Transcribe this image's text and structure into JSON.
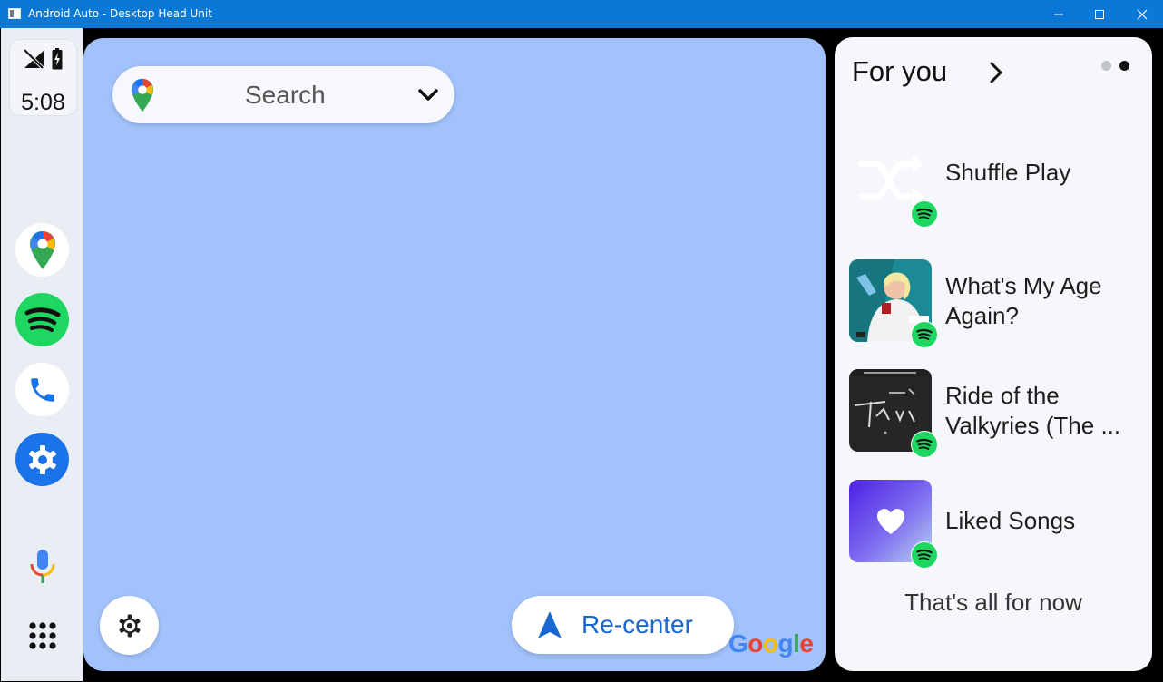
{
  "window": {
    "title": "Android Auto - Desktop Head Unit",
    "controls": [
      "minimize-icon",
      "maximize-icon",
      "close-icon"
    ]
  },
  "status": {
    "time": "5:08",
    "signal_icon": "no-signal-icon",
    "battery_icon": "battery-charging-icon"
  },
  "rail": {
    "apps": [
      {
        "name": "Google Maps",
        "icon": "maps-pin-icon"
      },
      {
        "name": "Spotify",
        "icon": "spotify-icon",
        "color": "#1ed760"
      },
      {
        "name": "Phone",
        "icon": "phone-icon"
      },
      {
        "name": "Settings",
        "icon": "settings-gear-icon",
        "color": "#1a73e8"
      }
    ],
    "assistant_icon": "microphone-icon",
    "launcher_icon": "app-grid-icon"
  },
  "map": {
    "search_label": "Search",
    "recenter_label": "Re-center",
    "attribution": [
      "G",
      "o",
      "o",
      "g",
      "l",
      "e"
    ],
    "attribution_colors": [
      "#4285F4",
      "#EA4335",
      "#FBBC05",
      "#4285F4",
      "#34A853",
      "#EA4335"
    ],
    "background": "#a1c2fa"
  },
  "panel": {
    "heading": "For you",
    "page_count": 2,
    "active_page": 2,
    "items": [
      {
        "title": "Shuffle Play",
        "art": "shuffle-icon"
      },
      {
        "title": "What's My Age Again?",
        "art": "album-art"
      },
      {
        "title": "Ride of the Valkyries (The ...",
        "art": "album-art"
      },
      {
        "title": "Liked Songs",
        "art": "heart-icon"
      }
    ],
    "footer": "That's all for now"
  }
}
